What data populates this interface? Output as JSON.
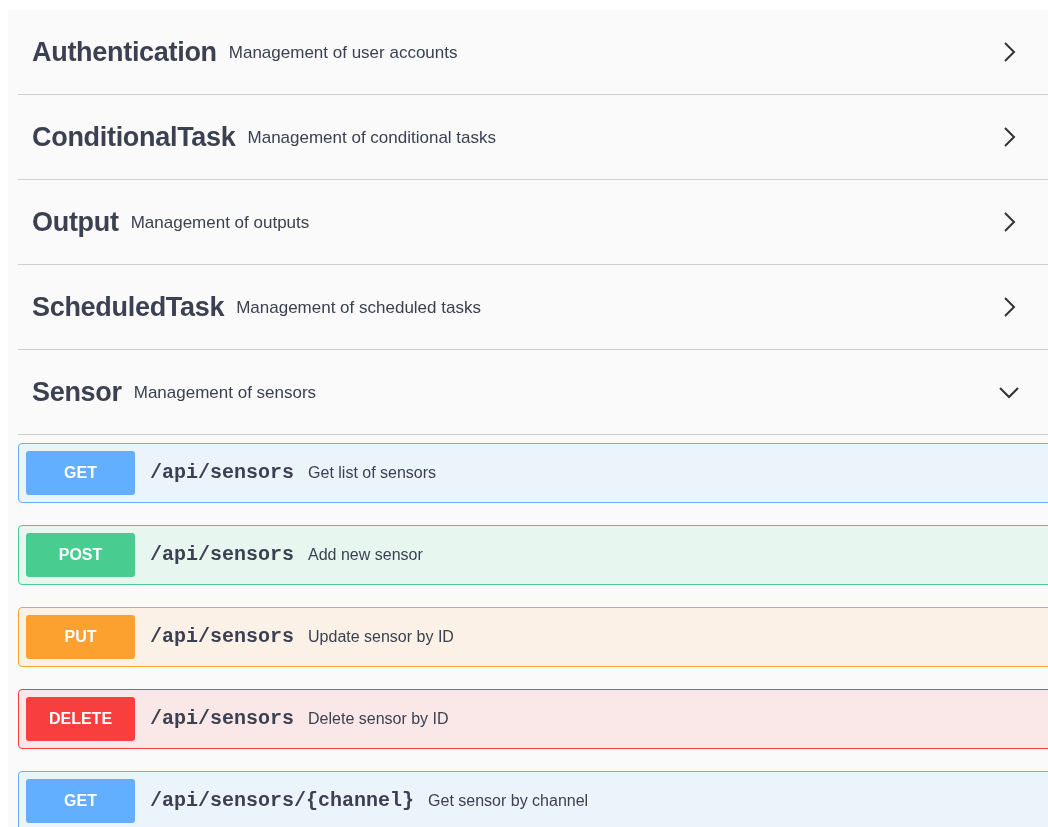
{
  "tags": [
    {
      "name": "Authentication",
      "description": "Management of user accounts",
      "expanded": false
    },
    {
      "name": "ConditionalTask",
      "description": "Management of conditional tasks",
      "expanded": false
    },
    {
      "name": "Output",
      "description": "Management of outputs",
      "expanded": false
    },
    {
      "name": "ScheduledTask",
      "description": "Management of scheduled tasks",
      "expanded": false
    },
    {
      "name": "Sensor",
      "description": "Management of sensors",
      "expanded": true,
      "operations": [
        {
          "kind": "get",
          "method": "GET",
          "path": "/api/sensors",
          "summary": "Get list of sensors"
        },
        {
          "kind": "post",
          "method": "POST",
          "path": "/api/sensors",
          "summary": "Add new sensor"
        },
        {
          "kind": "put",
          "method": "PUT",
          "path": "/api/sensors",
          "summary": "Update sensor by ID"
        },
        {
          "kind": "delete",
          "method": "DELETE",
          "path": "/api/sensors",
          "summary": "Delete sensor by ID"
        },
        {
          "kind": "get",
          "method": "GET",
          "path": "/api/sensors/{channel}",
          "summary": "Get sensor by channel"
        }
      ]
    }
  ]
}
